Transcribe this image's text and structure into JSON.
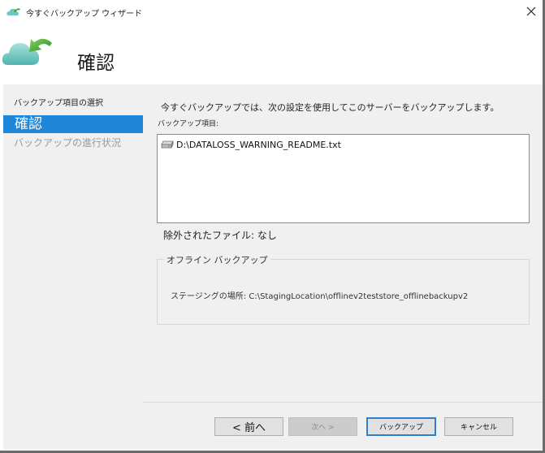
{
  "window": {
    "title": "今すぐバックアップ ウィザード",
    "close_glyph": "✕"
  },
  "header": {
    "title": "確認"
  },
  "nav": {
    "items": [
      {
        "label": "バックアップ項目の選択",
        "state": "completed"
      },
      {
        "label": "確認",
        "state": "active"
      },
      {
        "label": "バックアップの進行状況",
        "state": "pending"
      }
    ]
  },
  "content": {
    "intro": "今すぐバックアップでは、次の設定を使用してこのサーバーをバックアップします。",
    "items_label": "バックアップ項目:",
    "items": [
      {
        "icon": "drive-icon",
        "path": "D:\\DATALOSS_WARNING_README.txt"
      }
    ],
    "excluded": "除外されたファイル: なし",
    "offline": {
      "legend": "オフライン バックアップ",
      "staging": "ステージングの場所: C:\\StagingLocation\\offlinev2teststore_offlinebackupv2"
    }
  },
  "buttons": {
    "prev": "< 前へ",
    "next": "次へ >",
    "backup": "バックアップ",
    "cancel": "キャンセル"
  },
  "colors": {
    "accent": "#1f87d9",
    "nav_bg": "#f0f0f0",
    "disabled_text": "#9a9a9a"
  }
}
